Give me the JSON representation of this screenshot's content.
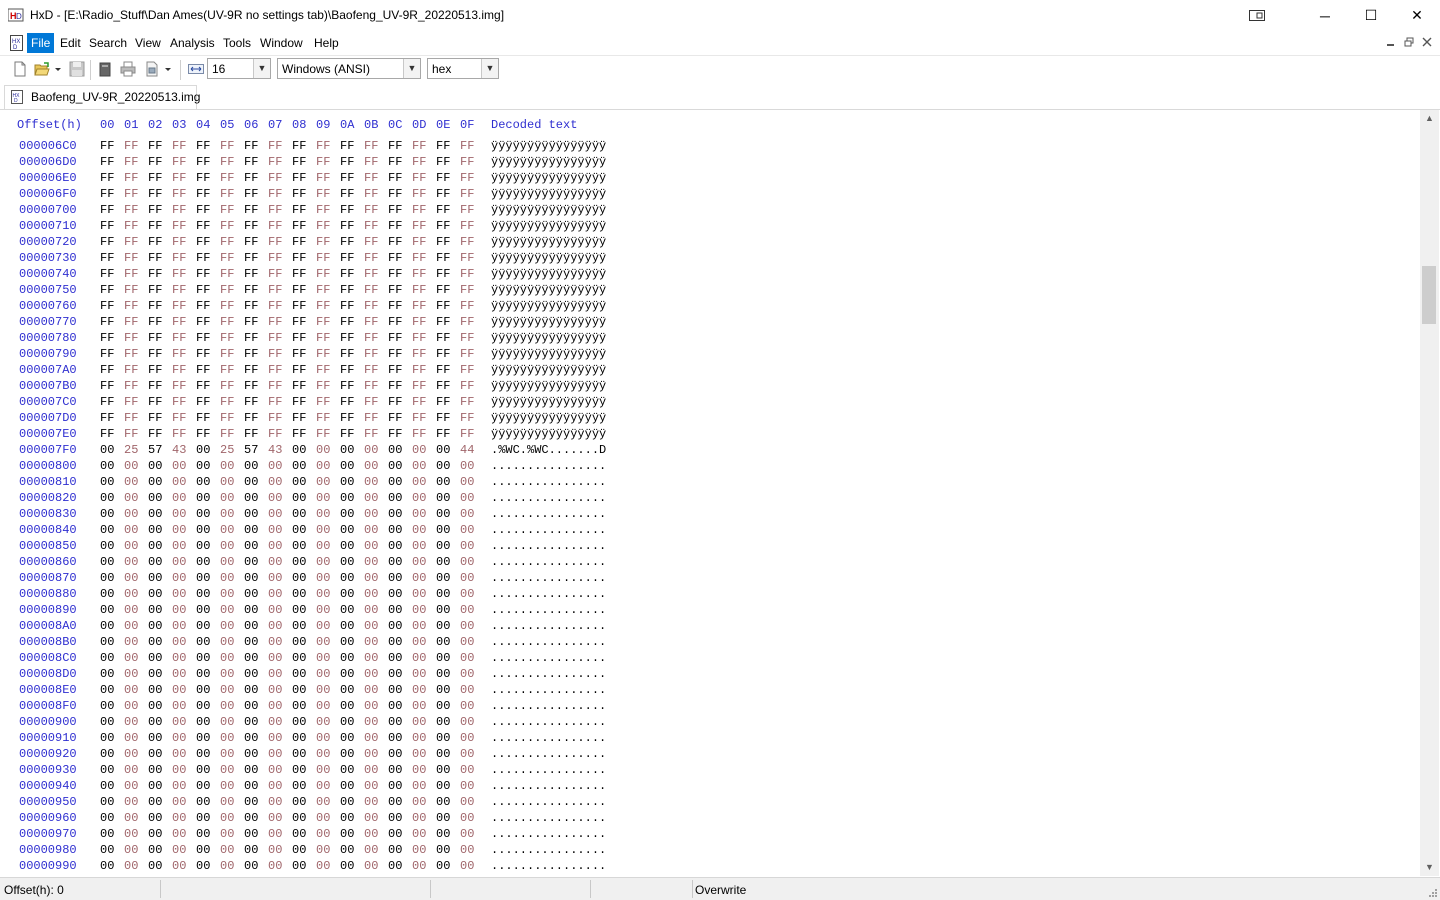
{
  "window": {
    "title": "HxD - [E:\\Radio_Stuff\\Dan Ames(UV-9R no settings tab)\\Baofeng_UV-9R_20220513.img]",
    "minimize_glyph": "─",
    "maximize_glyph": "☐",
    "close_glyph": "✕",
    "pin_icon": "window-snap-icon"
  },
  "menu": {
    "items": [
      "File",
      "Edit",
      "Search",
      "View",
      "Analysis",
      "Tools",
      "Window",
      "Help"
    ],
    "active": "File"
  },
  "toolbar": {
    "bytes_per_row": "16",
    "charset": "Windows (ANSI)",
    "offset_base": "hex",
    "icons": [
      "new-file-icon",
      "open-file-icon",
      "dropdown-icon",
      "save-icon",
      "properties-icon",
      "print-icon",
      "export-icon",
      "dropdown-icon",
      "bytes-per-row-icon"
    ]
  },
  "tabs": [
    {
      "label": "Baofeng_UV-9R_20220513.img",
      "active": true
    }
  ],
  "hex": {
    "offset_header": "Offset(h)",
    "columns": [
      "00",
      "01",
      "02",
      "03",
      "04",
      "05",
      "06",
      "07",
      "08",
      "09",
      "0A",
      "0B",
      "0C",
      "0D",
      "0E",
      "0F"
    ],
    "decoded_header": "Decoded text",
    "rows": [
      {
        "offset": "000006C0",
        "bytes": "FF FF FF FF FF FF FF FF FF FF FF FF FF FF FF FF",
        "text": "ÿÿÿÿÿÿÿÿÿÿÿÿÿÿÿÿ"
      },
      {
        "offset": "000006D0",
        "bytes": "FF FF FF FF FF FF FF FF FF FF FF FF FF FF FF FF",
        "text": "ÿÿÿÿÿÿÿÿÿÿÿÿÿÿÿÿ"
      },
      {
        "offset": "000006E0",
        "bytes": "FF FF FF FF FF FF FF FF FF FF FF FF FF FF FF FF",
        "text": "ÿÿÿÿÿÿÿÿÿÿÿÿÿÿÿÿ"
      },
      {
        "offset": "000006F0",
        "bytes": "FF FF FF FF FF FF FF FF FF FF FF FF FF FF FF FF",
        "text": "ÿÿÿÿÿÿÿÿÿÿÿÿÿÿÿÿ"
      },
      {
        "offset": "00000700",
        "bytes": "FF FF FF FF FF FF FF FF FF FF FF FF FF FF FF FF",
        "text": "ÿÿÿÿÿÿÿÿÿÿÿÿÿÿÿÿ"
      },
      {
        "offset": "00000710",
        "bytes": "FF FF FF FF FF FF FF FF FF FF FF FF FF FF FF FF",
        "text": "ÿÿÿÿÿÿÿÿÿÿÿÿÿÿÿÿ"
      },
      {
        "offset": "00000720",
        "bytes": "FF FF FF FF FF FF FF FF FF FF FF FF FF FF FF FF",
        "text": "ÿÿÿÿÿÿÿÿÿÿÿÿÿÿÿÿ"
      },
      {
        "offset": "00000730",
        "bytes": "FF FF FF FF FF FF FF FF FF FF FF FF FF FF FF FF",
        "text": "ÿÿÿÿÿÿÿÿÿÿÿÿÿÿÿÿ"
      },
      {
        "offset": "00000740",
        "bytes": "FF FF FF FF FF FF FF FF FF FF FF FF FF FF FF FF",
        "text": "ÿÿÿÿÿÿÿÿÿÿÿÿÿÿÿÿ"
      },
      {
        "offset": "00000750",
        "bytes": "FF FF FF FF FF FF FF FF FF FF FF FF FF FF FF FF",
        "text": "ÿÿÿÿÿÿÿÿÿÿÿÿÿÿÿÿ"
      },
      {
        "offset": "00000760",
        "bytes": "FF FF FF FF FF FF FF FF FF FF FF FF FF FF FF FF",
        "text": "ÿÿÿÿÿÿÿÿÿÿÿÿÿÿÿÿ"
      },
      {
        "offset": "00000770",
        "bytes": "FF FF FF FF FF FF FF FF FF FF FF FF FF FF FF FF",
        "text": "ÿÿÿÿÿÿÿÿÿÿÿÿÿÿÿÿ"
      },
      {
        "offset": "00000780",
        "bytes": "FF FF FF FF FF FF FF FF FF FF FF FF FF FF FF FF",
        "text": "ÿÿÿÿÿÿÿÿÿÿÿÿÿÿÿÿ"
      },
      {
        "offset": "00000790",
        "bytes": "FF FF FF FF FF FF FF FF FF FF FF FF FF FF FF FF",
        "text": "ÿÿÿÿÿÿÿÿÿÿÿÿÿÿÿÿ"
      },
      {
        "offset": "000007A0",
        "bytes": "FF FF FF FF FF FF FF FF FF FF FF FF FF FF FF FF",
        "text": "ÿÿÿÿÿÿÿÿÿÿÿÿÿÿÿÿ"
      },
      {
        "offset": "000007B0",
        "bytes": "FF FF FF FF FF FF FF FF FF FF FF FF FF FF FF FF",
        "text": "ÿÿÿÿÿÿÿÿÿÿÿÿÿÿÿÿ"
      },
      {
        "offset": "000007C0",
        "bytes": "FF FF FF FF FF FF FF FF FF FF FF FF FF FF FF FF",
        "text": "ÿÿÿÿÿÿÿÿÿÿÿÿÿÿÿÿ"
      },
      {
        "offset": "000007D0",
        "bytes": "FF FF FF FF FF FF FF FF FF FF FF FF FF FF FF FF",
        "text": "ÿÿÿÿÿÿÿÿÿÿÿÿÿÿÿÿ"
      },
      {
        "offset": "000007E0",
        "bytes": "FF FF FF FF FF FF FF FF FF FF FF FF FF FF FF FF",
        "text": "ÿÿÿÿÿÿÿÿÿÿÿÿÿÿÿÿ"
      },
      {
        "offset": "000007F0",
        "bytes": "00 25 57 43 00 25 57 43 00 00 00 00 00 00 00 44",
        "text": ".%WC.%WC.......D"
      },
      {
        "offset": "00000800",
        "bytes": "00 00 00 00 00 00 00 00 00 00 00 00 00 00 00 00",
        "text": "................"
      },
      {
        "offset": "00000810",
        "bytes": "00 00 00 00 00 00 00 00 00 00 00 00 00 00 00 00",
        "text": "................"
      },
      {
        "offset": "00000820",
        "bytes": "00 00 00 00 00 00 00 00 00 00 00 00 00 00 00 00",
        "text": "................"
      },
      {
        "offset": "00000830",
        "bytes": "00 00 00 00 00 00 00 00 00 00 00 00 00 00 00 00",
        "text": "................"
      },
      {
        "offset": "00000840",
        "bytes": "00 00 00 00 00 00 00 00 00 00 00 00 00 00 00 00",
        "text": "................"
      },
      {
        "offset": "00000850",
        "bytes": "00 00 00 00 00 00 00 00 00 00 00 00 00 00 00 00",
        "text": "................"
      },
      {
        "offset": "00000860",
        "bytes": "00 00 00 00 00 00 00 00 00 00 00 00 00 00 00 00",
        "text": "................"
      },
      {
        "offset": "00000870",
        "bytes": "00 00 00 00 00 00 00 00 00 00 00 00 00 00 00 00",
        "text": "................"
      },
      {
        "offset": "00000880",
        "bytes": "00 00 00 00 00 00 00 00 00 00 00 00 00 00 00 00",
        "text": "................"
      },
      {
        "offset": "00000890",
        "bytes": "00 00 00 00 00 00 00 00 00 00 00 00 00 00 00 00",
        "text": "................"
      },
      {
        "offset": "000008A0",
        "bytes": "00 00 00 00 00 00 00 00 00 00 00 00 00 00 00 00",
        "text": "................"
      },
      {
        "offset": "000008B0",
        "bytes": "00 00 00 00 00 00 00 00 00 00 00 00 00 00 00 00",
        "text": "................"
      },
      {
        "offset": "000008C0",
        "bytes": "00 00 00 00 00 00 00 00 00 00 00 00 00 00 00 00",
        "text": "................"
      },
      {
        "offset": "000008D0",
        "bytes": "00 00 00 00 00 00 00 00 00 00 00 00 00 00 00 00",
        "text": "................"
      },
      {
        "offset": "000008E0",
        "bytes": "00 00 00 00 00 00 00 00 00 00 00 00 00 00 00 00",
        "text": "................"
      },
      {
        "offset": "000008F0",
        "bytes": "00 00 00 00 00 00 00 00 00 00 00 00 00 00 00 00",
        "text": "................"
      },
      {
        "offset": "00000900",
        "bytes": "00 00 00 00 00 00 00 00 00 00 00 00 00 00 00 00",
        "text": "................"
      },
      {
        "offset": "00000910",
        "bytes": "00 00 00 00 00 00 00 00 00 00 00 00 00 00 00 00",
        "text": "................"
      },
      {
        "offset": "00000920",
        "bytes": "00 00 00 00 00 00 00 00 00 00 00 00 00 00 00 00",
        "text": "................"
      },
      {
        "offset": "00000930",
        "bytes": "00 00 00 00 00 00 00 00 00 00 00 00 00 00 00 00",
        "text": "................"
      },
      {
        "offset": "00000940",
        "bytes": "00 00 00 00 00 00 00 00 00 00 00 00 00 00 00 00",
        "text": "................"
      },
      {
        "offset": "00000950",
        "bytes": "00 00 00 00 00 00 00 00 00 00 00 00 00 00 00 00",
        "text": "................"
      },
      {
        "offset": "00000960",
        "bytes": "00 00 00 00 00 00 00 00 00 00 00 00 00 00 00 00",
        "text": "................"
      },
      {
        "offset": "00000970",
        "bytes": "00 00 00 00 00 00 00 00 00 00 00 00 00 00 00 00",
        "text": "................"
      },
      {
        "offset": "00000980",
        "bytes": "00 00 00 00 00 00 00 00 00 00 00 00 00 00 00 00",
        "text": "................"
      },
      {
        "offset": "00000990",
        "bytes": "00 00 00 00 00 00 00 00 00 00 00 00 00 00 00 00",
        "text": "................"
      }
    ]
  },
  "scrollbar": {
    "up_arrow": "▲",
    "down_arrow": "▼",
    "position": 0.2
  },
  "statusbar": {
    "offset": "Offset(h): 0",
    "mode": "Overwrite"
  },
  "colors": {
    "offset_blue": "#2f2fd0",
    "alt_byte": "#a0656a",
    "menu_active": "#0078d7"
  }
}
